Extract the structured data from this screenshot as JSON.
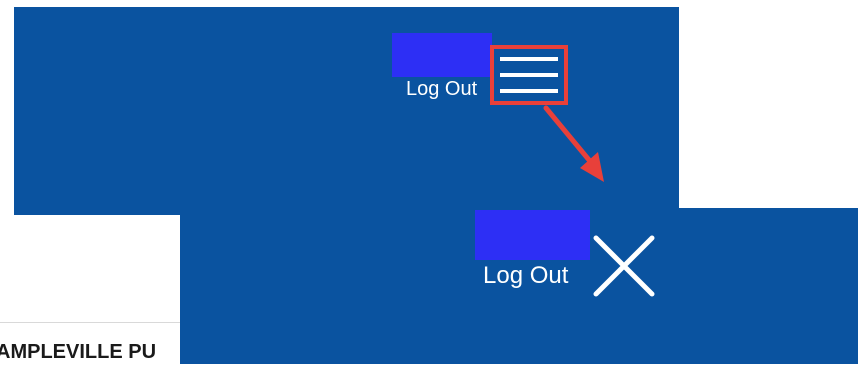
{
  "collapsed_header": {
    "logout_label": "Log Out",
    "menu_icon": "hamburger-menu-icon",
    "highlight_color": "#e8403a"
  },
  "annotation": {
    "arrow_icon": "arrow-down-right-icon",
    "arrow_color": "#e8403a"
  },
  "expanded_header": {
    "logout_label": "Log Out",
    "close_icon": "close-x-icon"
  },
  "colors": {
    "header_bg": "#0a53a0",
    "placeholder_block": "#2d2ff5",
    "text": "#ffffff"
  },
  "page": {
    "title_fragment": "AMPLEVILLE PU"
  }
}
